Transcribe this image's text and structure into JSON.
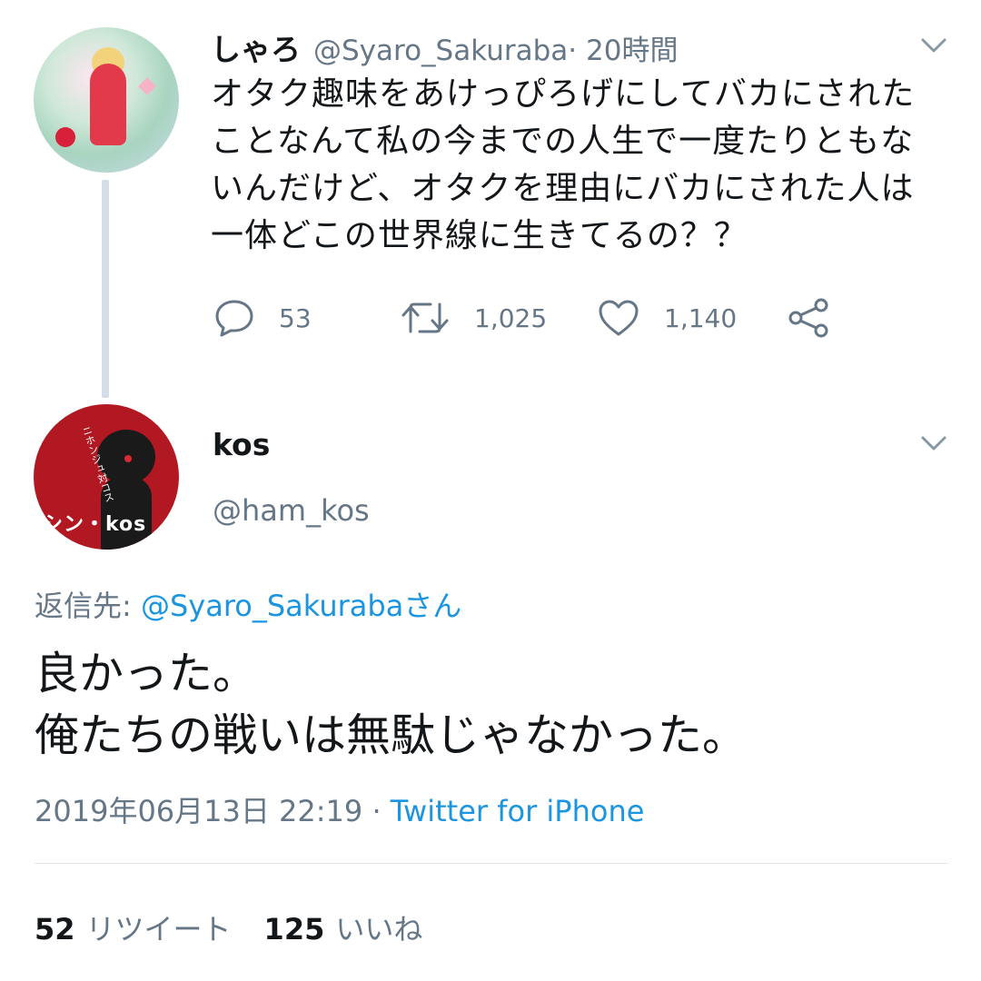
{
  "original_tweet": {
    "display_name": "しゃろ",
    "handle": "@Syaro_Sakuraba",
    "time_ago": " · 20時間",
    "text": "オタク趣味をあけっぴろげにしてバカにされた\nことなんて私の今までの人生で一度たりともな\nいんだけど、オタクを理由にバカにされた人は\n一体どこの世界線に生きてるの？？",
    "replies_count": "53",
    "retweets_count": "1,025",
    "likes_count": "1,140",
    "icons": {
      "reply": "reply-bubble-icon",
      "retweet": "retweet-icon",
      "like": "heart-icon",
      "share": "share-icon",
      "menu": "chevron-down-icon"
    }
  },
  "reply_tweet": {
    "display_name": "kos",
    "handle": "@ham_kos",
    "reply_to_label": "返信先: ",
    "reply_to_mention": "@Syaro_Sakurabaさん",
    "text": "良かった。\n俺たちの戦いは無駄じゃなかった。",
    "timestamp": "2019年06月13日 22:19",
    "meta_separator": " · ",
    "source": "Twitter for iPhone",
    "retweets_count": "52",
    "retweets_label": "リツイート",
    "likes_count": "125",
    "likes_label": "いいね",
    "avatar_logo_text": "シン・kos",
    "avatar_logo_subtext": "ニホンジュ対コス"
  },
  "colors": {
    "text_primary": "#14171a",
    "text_secondary": "#657786",
    "link": "#1b95e0",
    "thread_line": "#d5dee6",
    "divider": "#e1e8ed"
  }
}
